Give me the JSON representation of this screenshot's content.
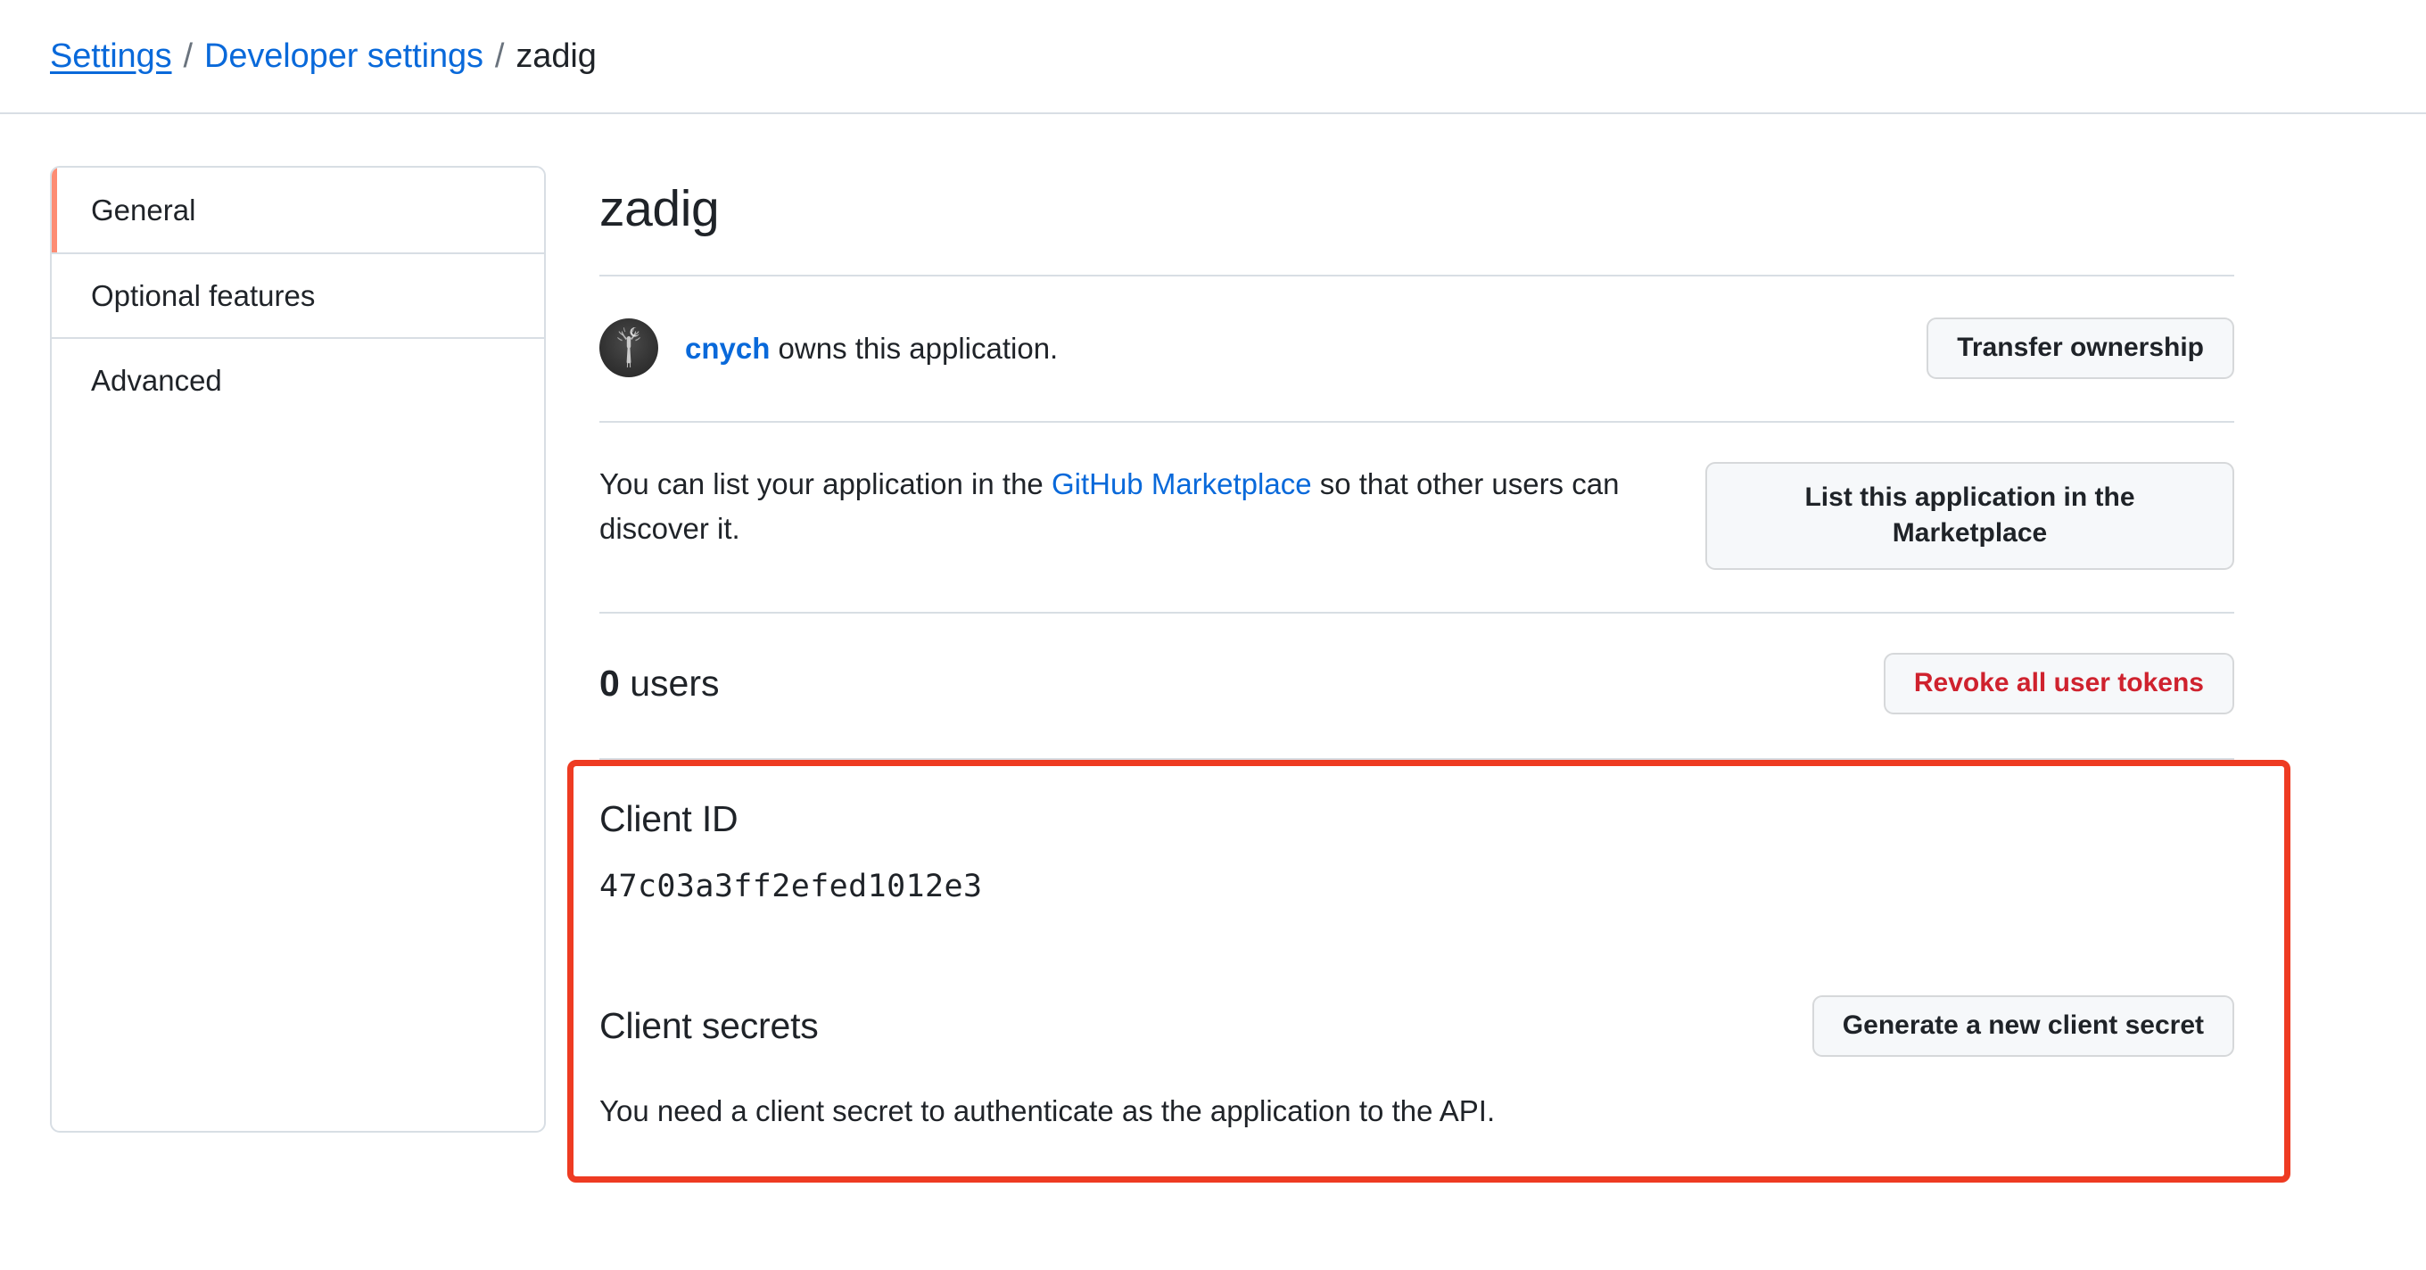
{
  "breadcrumb": {
    "items": [
      {
        "label": "Settings",
        "type": "link"
      },
      {
        "label": "Developer settings",
        "type": "link"
      },
      {
        "label": "zadig",
        "type": "current"
      }
    ],
    "separator": "/"
  },
  "sidebar": {
    "items": [
      {
        "label": "General",
        "selected": true
      },
      {
        "label": "Optional features",
        "selected": false
      },
      {
        "label": "Advanced",
        "selected": false
      }
    ],
    "selected_accent_color": "#fd8c73"
  },
  "main": {
    "app_title": "zadig",
    "owner": {
      "name": "cnych",
      "suffix_text": " owns this application.",
      "avatar_alt": "deer-avatar",
      "transfer_button": "Transfer ownership"
    },
    "marketplace": {
      "text_before": "You can list your application in the ",
      "link_text": "GitHub Marketplace",
      "text_after": " so that other users can discover it.",
      "button": "List this application in the Marketplace"
    },
    "users": {
      "count": "0",
      "label": "users",
      "revoke_button": "Revoke all user tokens",
      "revoke_button_color": "#cf222e"
    },
    "client_id": {
      "heading": "Client ID",
      "value": "47c03a3ff2efed1012e3"
    },
    "client_secrets": {
      "heading": "Client secrets",
      "generate_button": "Generate a new client secret",
      "description": "You need a client secret to authenticate as the application to the API."
    }
  },
  "annotation": {
    "color": "#ee3b22"
  }
}
